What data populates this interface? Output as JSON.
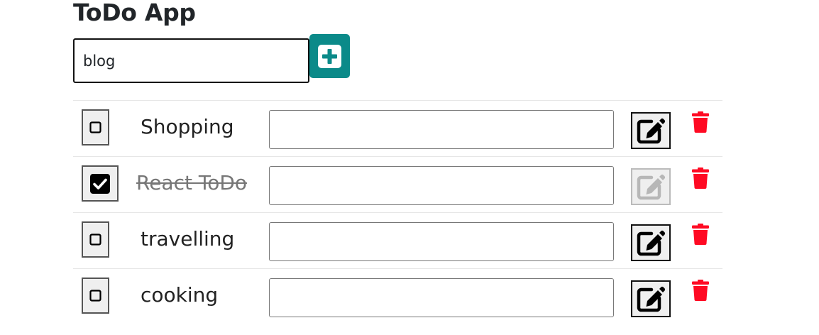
{
  "app": {
    "title": "ToDo App"
  },
  "new_todo": {
    "value": "blog",
    "placeholder": ""
  },
  "todos": [
    {
      "text": "Shopping",
      "completed": false,
      "edit_value": ""
    },
    {
      "text": "React ToDo",
      "completed": true,
      "edit_value": ""
    },
    {
      "text": "travelling",
      "completed": false,
      "edit_value": ""
    },
    {
      "text": "cooking",
      "completed": false,
      "edit_value": ""
    }
  ],
  "colors": {
    "add_button": "#0b8a89",
    "delete_icon": "#ff0a23",
    "completed_text": "#777777"
  },
  "icons": {
    "add": "plus-square-icon",
    "edit": "pen-to-square-icon",
    "delete": "trash-icon",
    "checked": "check-square-icon",
    "unchecked": "square-icon"
  }
}
